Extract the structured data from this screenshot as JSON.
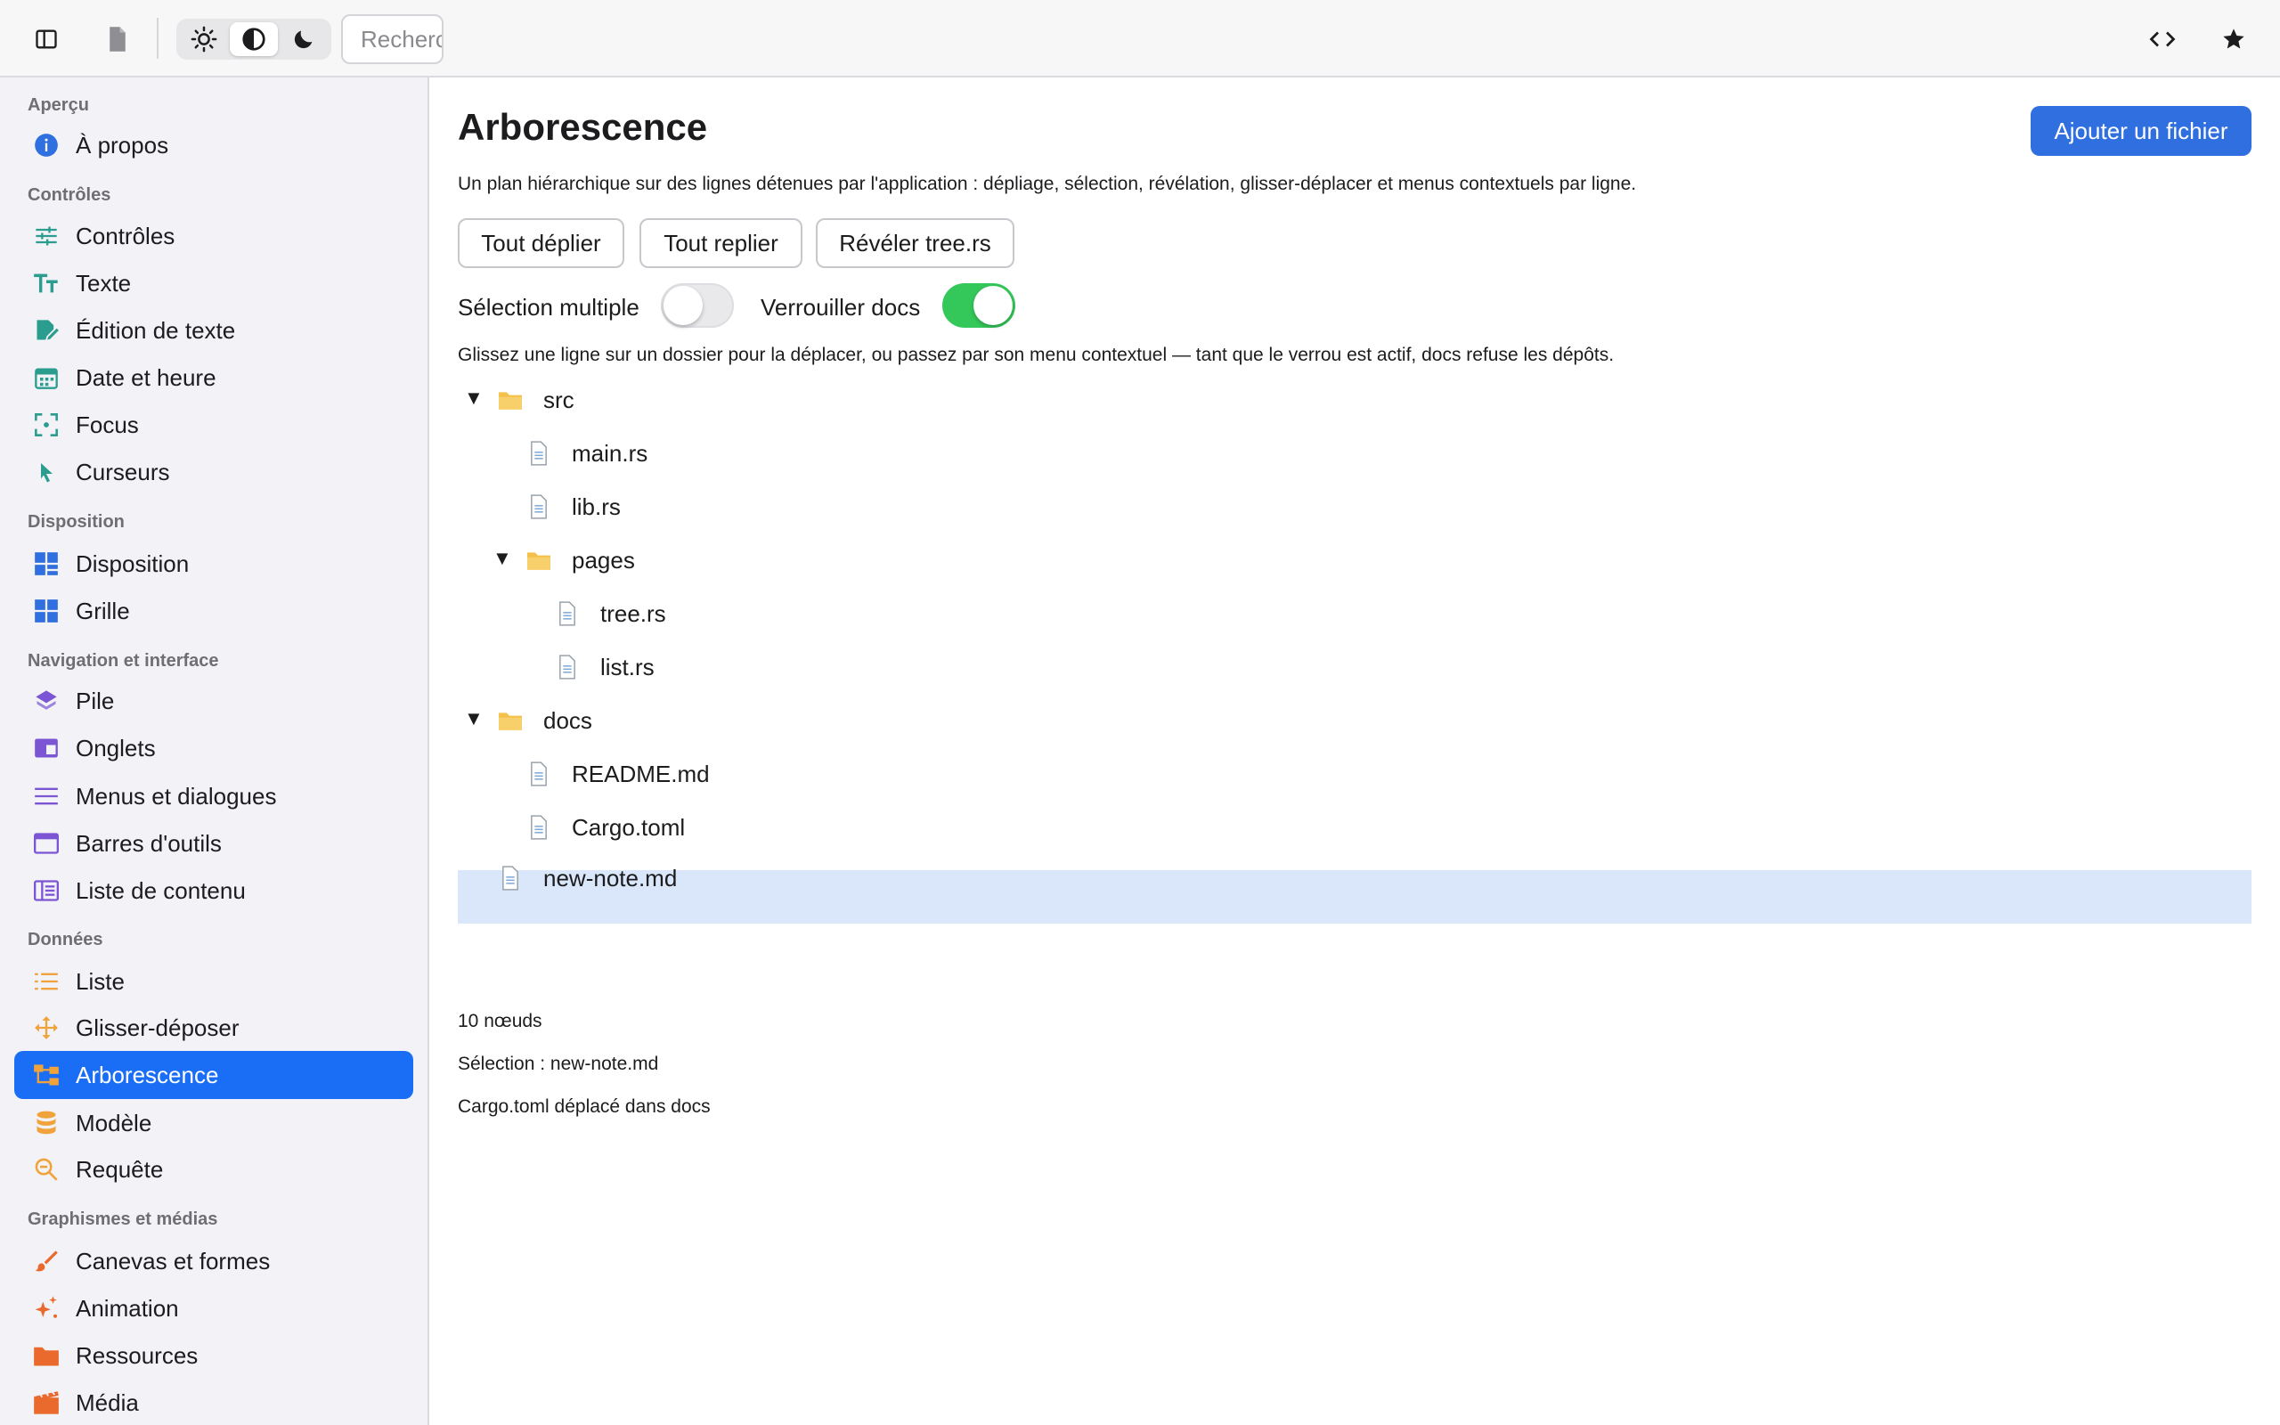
{
  "toolbar": {
    "sidebar_toggle_icon": "sidebar-icon",
    "document_icon": "document-icon",
    "theme_options": [
      "sun-icon",
      "contrast-icon",
      "moon-icon"
    ],
    "theme_selected": "contrast-icon",
    "search_placeholder": "Recherche",
    "code_icon": "code-icon",
    "star_icon": "star-icon"
  },
  "sidebar": {
    "sections": [
      {
        "title": "Aperçu",
        "items": [
          {
            "label": "À propos",
            "icon": "info-icon",
            "color": "#2f6fe0"
          }
        ]
      },
      {
        "title": "Contrôles",
        "items": [
          {
            "label": "Contrôles",
            "icon": "sliders-icon",
            "color": "#2a9d8f"
          },
          {
            "label": "Texte",
            "icon": "text-icon",
            "color": "#2a9d8f"
          },
          {
            "label": "Édition de texte",
            "icon": "edit-icon",
            "color": "#2a9d8f"
          },
          {
            "label": "Date et heure",
            "icon": "calendar-icon",
            "color": "#2a9d8f"
          },
          {
            "label": "Focus",
            "icon": "focus-icon",
            "color": "#2a9d8f"
          },
          {
            "label": "Curseurs",
            "icon": "cursor-icon",
            "color": "#2a9d8f"
          }
        ]
      },
      {
        "title": "Disposition",
        "items": [
          {
            "label": "Disposition",
            "icon": "layout-icon",
            "color": "#2f6fe0"
          },
          {
            "label": "Grille",
            "icon": "grid-icon",
            "color": "#2f6fe0"
          }
        ]
      },
      {
        "title": "Navigation et interface",
        "items": [
          {
            "label": "Pile",
            "icon": "stack-icon",
            "color": "#7b55d4"
          },
          {
            "label": "Onglets",
            "icon": "tabs-icon",
            "color": "#7b55d4"
          },
          {
            "label": "Menus et dialogues",
            "icon": "menu-icon",
            "color": "#7b55d4"
          },
          {
            "label": "Barres d'outils",
            "icon": "toolbar-icon",
            "color": "#7b55d4"
          },
          {
            "label": "Liste de contenu",
            "icon": "content-list-icon",
            "color": "#7b55d4"
          }
        ]
      },
      {
        "title": "Données",
        "items": [
          {
            "label": "Liste",
            "icon": "list-icon",
            "color": "#f0a33a"
          },
          {
            "label": "Glisser-déposer",
            "icon": "move-icon",
            "color": "#f0a33a"
          },
          {
            "label": "Arborescence",
            "icon": "tree-icon",
            "color": "#f0a33a"
          },
          {
            "label": "Modèle",
            "icon": "database-icon",
            "color": "#f0a33a"
          },
          {
            "label": "Requête",
            "icon": "magnifier-icon",
            "color": "#f0a33a"
          }
        ]
      },
      {
        "title": "Graphismes et médias",
        "items": [
          {
            "label": "Canevas et formes",
            "icon": "brush-icon",
            "color": "#ea6a2e"
          },
          {
            "label": "Animation",
            "icon": "sparkle-icon",
            "color": "#ea6a2e"
          },
          {
            "label": "Ressources",
            "icon": "folder-icon",
            "color": "#ea6a2e"
          },
          {
            "label": "Média",
            "icon": "film-icon",
            "color": "#ea6a2e"
          }
        ]
      }
    ],
    "active_item": "Arborescence"
  },
  "main": {
    "title": "Arborescence",
    "add_button": "Ajouter un fichier",
    "description": "Un plan hiérarchique sur des lignes détenues par l'application : dépliage, sélection, révélation, glisser-déplacer et menus contextuels par ligne.",
    "actions": [
      "Tout déplier",
      "Tout replier",
      "Révéler tree.rs"
    ],
    "multi_select": {
      "label": "Sélection multiple",
      "on": false
    },
    "lock_docs": {
      "label": "Verrouiller docs",
      "on": true
    },
    "hint": "Glissez une ligne sur un dossier pour la déplacer, ou passez par son menu contextuel — tant que le verrou est actif, docs refuse les dépôts.",
    "tree": [
      {
        "label": "src",
        "type": "folder",
        "depth": 0,
        "expanded": true
      },
      {
        "label": "main.rs",
        "type": "file",
        "depth": 1
      },
      {
        "label": "lib.rs",
        "type": "file",
        "depth": 1
      },
      {
        "label": "pages",
        "type": "folder",
        "depth": 1,
        "expanded": true
      },
      {
        "label": "tree.rs",
        "type": "file",
        "depth": 2
      },
      {
        "label": "list.rs",
        "type": "file",
        "depth": 2
      },
      {
        "label": "docs",
        "type": "folder",
        "depth": 0,
        "expanded": true
      },
      {
        "label": "README.md",
        "type": "file",
        "depth": 1
      },
      {
        "label": "Cargo.toml",
        "type": "file",
        "depth": 1
      },
      {
        "label": "new-note.md",
        "type": "file",
        "depth": 0,
        "selected": true
      }
    ],
    "status": {
      "count": "10 nœuds",
      "selection": "Sélection : new-note.md",
      "last_action": "Cargo.toml déplacé dans docs"
    }
  }
}
